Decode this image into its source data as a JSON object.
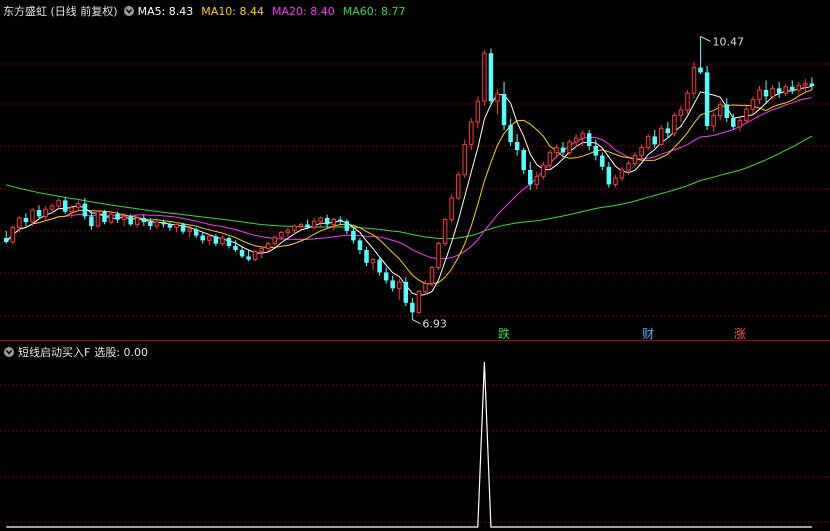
{
  "header": {
    "title": "东方盛虹 (日线 前复权)",
    "indicators": [
      {
        "label": "MA5: 8.43",
        "color": "#ffffff"
      },
      {
        "label": "MA10: 8.44",
        "color": "#ffd000"
      },
      {
        "label": "MA20: 8.40",
        "color": "#ff33ff"
      },
      {
        "label": "MA60: 8.77",
        "color": "#33dd33"
      }
    ]
  },
  "sub_header": {
    "title": "短线启动买入F",
    "value_label": "选股: 0.00"
  },
  "colors": {
    "up": "#ff3333",
    "down": "#54ffff",
    "grid": "#7a0000",
    "ma5": "#ffffff",
    "ma10": "#ffd000",
    "ma20": "#ff33ff",
    "ma60": "#33dd33"
  },
  "chart_data": [
    {
      "type": "candlestick",
      "y_range": [
        6.8,
        10.6
      ],
      "price_labels": {
        "high": "10.47",
        "low": "6.93"
      },
      "event_markers": [
        {
          "text": "跌",
          "index": 76,
          "color": "#33dd33"
        },
        {
          "text": "财",
          "index": 98,
          "color": "#5ab4ff"
        },
        {
          "text": "涨",
          "index": 112,
          "color": "#ff5555"
        }
      ],
      "moving_averages": [
        {
          "name": "MA5",
          "period": 5,
          "value": 8.43
        },
        {
          "name": "MA10",
          "period": 10,
          "value": 8.44
        },
        {
          "name": "MA20",
          "period": 20,
          "value": 8.4
        },
        {
          "name": "MA60",
          "period": 60,
          "value": 8.77
        }
      ],
      "ohlc": [
        [
          7.95,
          8.04,
          7.88,
          7.9
        ],
        [
          7.9,
          8.1,
          7.87,
          8.08
        ],
        [
          8.08,
          8.22,
          8.02,
          8.2
        ],
        [
          8.2,
          8.26,
          8.1,
          8.15
        ],
        [
          8.15,
          8.32,
          8.1,
          8.3
        ],
        [
          8.3,
          8.36,
          8.2,
          8.22
        ],
        [
          8.22,
          8.34,
          8.18,
          8.31
        ],
        [
          8.31,
          8.38,
          8.25,
          8.35
        ],
        [
          8.35,
          8.45,
          8.3,
          8.42
        ],
        [
          8.42,
          8.46,
          8.25,
          8.28
        ],
        [
          8.28,
          8.36,
          8.2,
          8.33
        ],
        [
          8.33,
          8.42,
          8.28,
          8.38
        ],
        [
          8.38,
          8.45,
          8.18,
          8.22
        ],
        [
          8.22,
          8.3,
          8.05,
          8.1
        ],
        [
          8.1,
          8.3,
          8.08,
          8.28
        ],
        [
          8.28,
          8.3,
          8.12,
          8.15
        ],
        [
          8.15,
          8.28,
          8.12,
          8.25
        ],
        [
          8.25,
          8.28,
          8.14,
          8.18
        ],
        [
          8.18,
          8.26,
          8.1,
          8.22
        ],
        [
          8.22,
          8.25,
          8.1,
          8.12
        ],
        [
          8.12,
          8.22,
          8.08,
          8.2
        ],
        [
          8.2,
          8.24,
          8.1,
          8.15
        ],
        [
          8.15,
          8.2,
          8.05,
          8.1
        ],
        [
          8.1,
          8.18,
          8.06,
          8.15
        ],
        [
          8.15,
          8.18,
          8.08,
          8.12
        ],
        [
          8.12,
          8.16,
          8.04,
          8.08
        ],
        [
          8.08,
          8.15,
          8.02,
          8.12
        ],
        [
          8.12,
          8.14,
          8.0,
          8.03
        ],
        [
          8.03,
          8.1,
          7.96,
          8.06
        ],
        [
          8.06,
          8.08,
          7.95,
          7.98
        ],
        [
          7.98,
          8.02,
          7.88,
          7.92
        ],
        [
          7.92,
          8.0,
          7.86,
          7.97
        ],
        [
          7.97,
          8.0,
          7.85,
          7.88
        ],
        [
          7.88,
          7.98,
          7.85,
          7.95
        ],
        [
          7.95,
          7.97,
          7.82,
          7.85
        ],
        [
          7.85,
          7.92,
          7.78,
          7.8
        ],
        [
          7.8,
          7.84,
          7.7,
          7.72
        ],
        [
          7.72,
          7.8,
          7.66,
          7.68
        ],
        [
          7.68,
          7.8,
          7.66,
          7.78
        ],
        [
          7.78,
          7.84,
          7.7,
          7.82
        ],
        [
          7.82,
          7.9,
          7.78,
          7.88
        ],
        [
          7.88,
          7.98,
          7.85,
          7.96
        ],
        [
          7.96,
          8.04,
          7.92,
          8.02
        ],
        [
          8.02,
          8.08,
          7.96,
          8.05
        ],
        [
          8.05,
          8.12,
          8.0,
          8.1
        ],
        [
          8.1,
          8.14,
          8.04,
          8.12
        ],
        [
          8.12,
          8.18,
          8.06,
          8.08
        ],
        [
          8.08,
          8.2,
          8.06,
          8.16
        ],
        [
          8.16,
          8.22,
          8.1,
          8.2
        ],
        [
          8.2,
          8.24,
          8.08,
          8.12
        ],
        [
          8.12,
          8.2,
          8.05,
          8.18
        ],
        [
          8.18,
          8.22,
          8.12,
          8.16
        ],
        [
          8.16,
          8.18,
          8.0,
          8.04
        ],
        [
          8.04,
          8.08,
          7.88,
          7.92
        ],
        [
          7.92,
          7.95,
          7.75,
          7.8
        ],
        [
          7.8,
          7.84,
          7.6,
          7.64
        ],
        [
          7.64,
          7.7,
          7.55,
          7.68
        ],
        [
          7.68,
          7.72,
          7.48,
          7.52
        ],
        [
          7.52,
          7.58,
          7.38,
          7.42
        ],
        [
          7.42,
          7.48,
          7.28,
          7.32
        ],
        [
          7.32,
          7.44,
          7.18,
          7.4
        ],
        [
          7.4,
          7.46,
          7.1,
          7.14
        ],
        [
          7.14,
          7.2,
          6.93,
          7.02
        ],
        [
          7.02,
          7.3,
          7.0,
          7.28
        ],
        [
          7.28,
          7.42,
          7.24,
          7.38
        ],
        [
          7.38,
          7.6,
          7.34,
          7.58
        ],
        [
          7.58,
          7.9,
          7.55,
          7.88
        ],
        [
          7.88,
          8.2,
          7.85,
          8.18
        ],
        [
          8.18,
          8.5,
          8.15,
          8.45
        ],
        [
          8.45,
          8.78,
          8.42,
          8.74
        ],
        [
          8.74,
          9.18,
          8.7,
          9.12
        ],
        [
          9.12,
          9.45,
          9.05,
          9.4
        ],
        [
          9.4,
          9.72,
          9.32,
          9.66
        ],
        [
          9.66,
          10.3,
          9.6,
          10.26
        ],
        [
          10.26,
          10.32,
          9.6,
          9.66
        ],
        [
          9.66,
          9.8,
          9.5,
          9.75
        ],
        [
          9.75,
          9.9,
          9.3,
          9.36
        ],
        [
          9.36,
          9.44,
          9.1,
          9.15
        ],
        [
          9.15,
          9.25,
          8.98,
          9.05
        ],
        [
          9.05,
          9.08,
          8.75,
          8.8
        ],
        [
          8.8,
          8.9,
          8.55,
          8.62
        ],
        [
          8.62,
          8.78,
          8.56,
          8.72
        ],
        [
          8.72,
          8.9,
          8.68,
          8.86
        ],
        [
          8.86,
          9.05,
          8.82,
          9.02
        ],
        [
          9.02,
          9.12,
          8.95,
          9.08
        ],
        [
          9.08,
          9.15,
          8.98,
          9.02
        ],
        [
          9.02,
          9.18,
          8.98,
          9.15
        ],
        [
          9.15,
          9.25,
          9.08,
          9.2
        ],
        [
          9.2,
          9.3,
          9.1,
          9.26
        ],
        [
          9.26,
          9.3,
          9.05,
          9.1
        ],
        [
          9.1,
          9.18,
          8.92,
          8.98
        ],
        [
          8.98,
          9.02,
          8.8,
          8.84
        ],
        [
          8.84,
          8.9,
          8.58,
          8.62
        ],
        [
          8.62,
          8.74,
          8.58,
          8.7
        ],
        [
          8.7,
          8.84,
          8.66,
          8.8
        ],
        [
          8.8,
          8.92,
          8.74,
          8.88
        ],
        [
          8.88,
          9.02,
          8.84,
          8.98
        ],
        [
          8.98,
          9.12,
          8.94,
          9.08
        ],
        [
          9.08,
          9.25,
          9.05,
          9.22
        ],
        [
          9.22,
          9.3,
          9.08,
          9.12
        ],
        [
          9.12,
          9.36,
          9.1,
          9.32
        ],
        [
          9.32,
          9.4,
          9.2,
          9.26
        ],
        [
          9.26,
          9.52,
          9.22,
          9.48
        ],
        [
          9.48,
          9.6,
          9.4,
          9.55
        ],
        [
          9.55,
          9.8,
          9.5,
          9.76
        ],
        [
          9.76,
          10.15,
          9.7,
          10.08
        ],
        [
          10.08,
          10.47,
          10.0,
          10.02
        ],
        [
          10.02,
          10.1,
          9.3,
          9.35
        ],
        [
          9.35,
          9.52,
          9.28,
          9.48
        ],
        [
          9.48,
          9.66,
          9.42,
          9.62
        ],
        [
          9.62,
          9.7,
          9.4,
          9.45
        ],
        [
          9.45,
          9.5,
          9.3,
          9.34
        ],
        [
          9.34,
          9.46,
          9.28,
          9.42
        ],
        [
          9.42,
          9.6,
          9.38,
          9.56
        ],
        [
          9.56,
          9.72,
          9.5,
          9.68
        ],
        [
          9.68,
          9.85,
          9.62,
          9.8
        ],
        [
          9.8,
          9.92,
          9.65,
          9.72
        ],
        [
          9.72,
          9.86,
          9.68,
          9.82
        ],
        [
          9.82,
          9.9,
          9.7,
          9.76
        ],
        [
          9.76,
          9.88,
          9.72,
          9.84
        ],
        [
          9.84,
          9.92,
          9.75,
          9.8
        ],
        [
          9.8,
          9.9,
          9.74,
          9.86
        ],
        [
          9.86,
          9.94,
          9.78,
          9.88
        ],
        [
          9.88,
          9.96,
          9.8,
          9.85
        ]
      ],
      "ma60_seed": [
        9.45,
        9.42,
        9.39,
        9.36,
        9.33,
        9.3,
        9.27,
        9.24,
        9.21,
        9.18,
        9.15,
        9.12,
        9.09,
        9.06,
        9.03,
        9.0,
        8.97,
        8.94,
        8.91,
        8.88,
        8.85,
        8.82,
        8.79,
        8.76,
        8.73,
        8.7,
        8.67,
        8.64,
        8.61,
        8.58,
        8.55,
        8.53,
        8.51,
        8.49,
        8.47,
        8.45,
        8.43,
        8.41,
        8.39,
        8.37,
        8.35,
        8.33,
        8.31,
        8.29,
        8.27,
        8.25,
        8.23,
        8.21,
        8.19,
        8.17,
        8.15,
        8.13,
        8.11,
        8.09,
        8.07,
        8.06,
        8.05,
        8.04,
        8.03,
        8.02
      ]
    },
    {
      "type": "line",
      "name": "选股",
      "y_range": [
        0,
        1
      ],
      "values_note_index": 73,
      "values": "0 everywhere except 1 at index 73"
    }
  ]
}
